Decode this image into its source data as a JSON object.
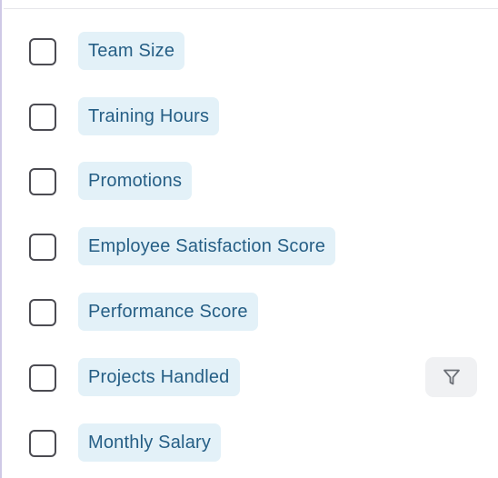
{
  "fields": [
    {
      "label": "Team Size",
      "checked": false
    },
    {
      "label": "Training Hours",
      "checked": false
    },
    {
      "label": "Promotions",
      "checked": false
    },
    {
      "label": "Employee Satisfaction Score",
      "checked": false
    },
    {
      "label": "Performance Score",
      "checked": false
    },
    {
      "label": "Projects Handled",
      "checked": false
    },
    {
      "label": "Monthly Salary",
      "checked": false
    }
  ],
  "filter_button": {
    "icon": "filter-icon"
  },
  "colors": {
    "chip_background": "#e3f1f8",
    "chip_text": "#255e85",
    "checkbox_border": "#4b4b52",
    "panel_border": "#cfc9e6",
    "filter_button_background": "#f0f1f3",
    "filter_icon": "#6b6f76"
  }
}
